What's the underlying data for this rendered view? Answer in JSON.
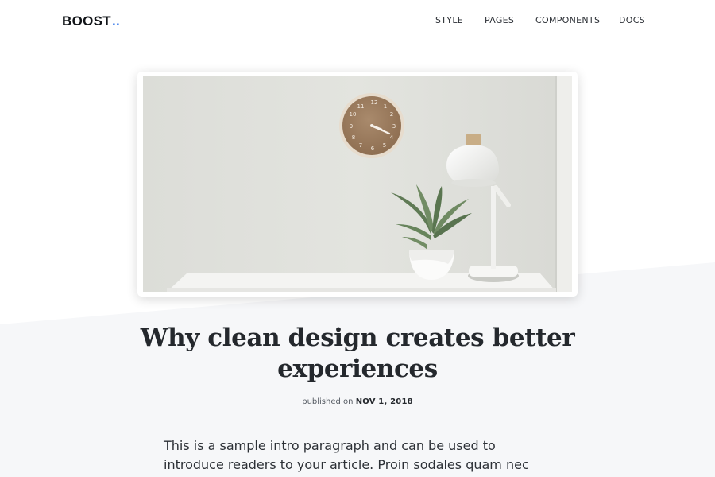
{
  "brand": {
    "name": "BOOST",
    "dots": ".."
  },
  "nav": {
    "items": [
      "STYLE",
      "PAGES",
      "COMPONENTS",
      "DOCS"
    ]
  },
  "article": {
    "title": "Why clean design creates better experiences",
    "meta_prefix": "published on",
    "date": "NOV 1, 2018",
    "intro": "This is a sample intro paragraph and can be used to introduce readers to your article. Proin sodales quam nec ante sollicitudin lacinia. Ut egestas bibendum..."
  },
  "clock_numbers": [
    "12",
    "1",
    "2",
    "3",
    "4",
    "5",
    "6",
    "7",
    "8",
    "9",
    "10",
    "11"
  ],
  "colors": {
    "accent": "#3a7bea",
    "text": "#24282d",
    "muted_bg": "#f6f7f9"
  }
}
